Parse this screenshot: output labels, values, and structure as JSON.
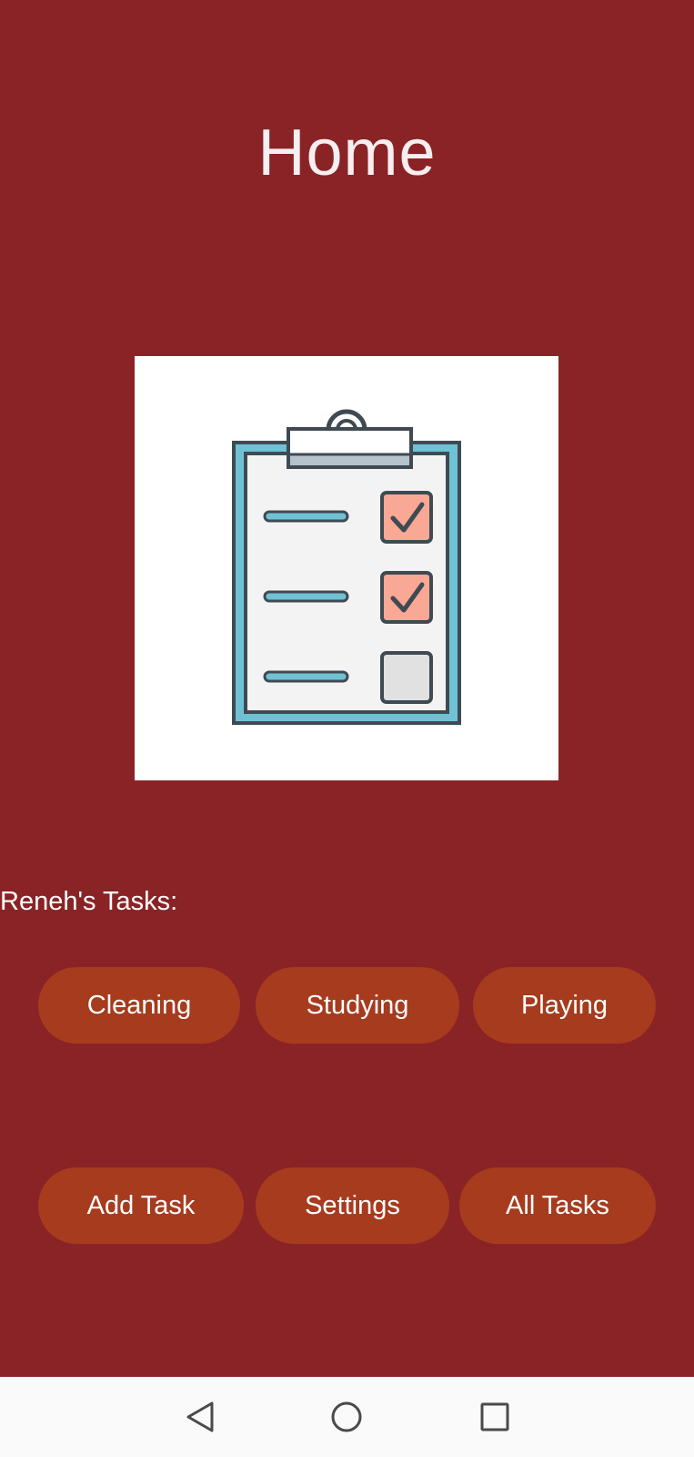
{
  "header": {
    "title": "Home"
  },
  "hero": {
    "icon": "clipboard-checklist-icon"
  },
  "tasks_section": {
    "label": "Reneh's Tasks:",
    "tasks": [
      "Cleaning",
      "Studying",
      "Playing"
    ]
  },
  "actions": {
    "add_task": "Add Task",
    "settings": "Settings",
    "all_tasks": "All Tasks"
  },
  "nav_bar": {
    "back_icon": "triangle-back-icon",
    "home_icon": "circle-home-icon",
    "recents_icon": "square-recents-icon"
  },
  "colors": {
    "background": "#8a2325",
    "button": "#a63b1e",
    "text": "#ffffff",
    "nav_bar": "#fafafa"
  }
}
